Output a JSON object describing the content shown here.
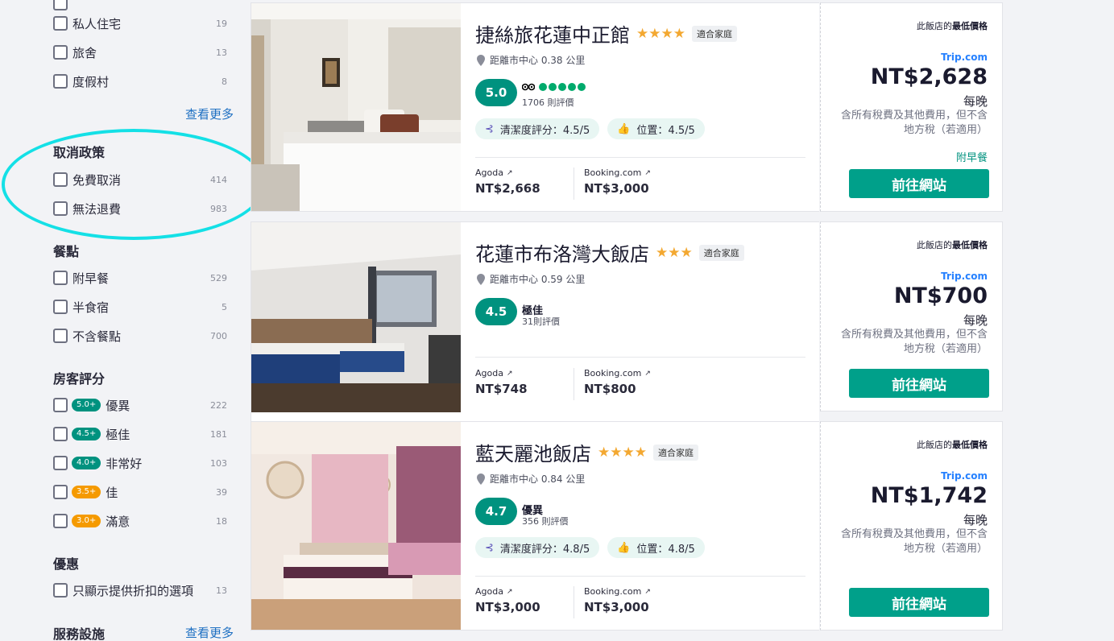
{
  "sidebar": {
    "property_types": [
      {
        "label": "私人住宅",
        "count": "19"
      },
      {
        "label": "旅舍",
        "count": "13"
      },
      {
        "label": "度假村",
        "count": "8"
      }
    ],
    "see_more": "查看更多",
    "cancellation": {
      "title": "取消政策",
      "items": [
        {
          "label": "免費取消",
          "count": "414"
        },
        {
          "label": "無法退費",
          "count": "983"
        }
      ]
    },
    "meals": {
      "title": "餐點",
      "items": [
        {
          "label": "附早餐",
          "count": "529"
        },
        {
          "label": "半食宿",
          "count": "5"
        },
        {
          "label": "不含餐點",
          "count": "700"
        }
      ]
    },
    "guest_rating": {
      "title": "房客評分",
      "items": [
        {
          "badge": "5.0+",
          "label": "優異",
          "count": "222",
          "color": "#00927f"
        },
        {
          "badge": "4.5+",
          "label": "極佳",
          "count": "181",
          "color": "#00927f"
        },
        {
          "badge": "4.0+",
          "label": "非常好",
          "count": "103",
          "color": "#00927f"
        },
        {
          "badge": "3.5+",
          "label": "佳",
          "count": "39",
          "color": "#f59a00"
        },
        {
          "badge": "3.0+",
          "label": "滿意",
          "count": "18",
          "color": "#f59a00"
        }
      ]
    },
    "deals": {
      "title": "優惠",
      "items": [
        {
          "label": "只顯示提供折扣的選項",
          "count": "13"
        }
      ]
    },
    "facilities": {
      "title": "服務設施",
      "see_more": "查看更多"
    }
  },
  "hotels": [
    {
      "name": "捷絲旅花蓮中正館",
      "stars": "★★★★",
      "tag": "適合家庭",
      "distance": "距離市中心 0.38 公里",
      "score": "5.0",
      "score_word": "",
      "reviews": "1706 則評價",
      "cleanliness": "清潔度評分：4.5/5",
      "location": "位置：4.5/5",
      "provider1": "Agoda",
      "provider1_price": "NT$2,668",
      "provider2": "Booking.com",
      "provider2_price": "NT$3,000",
      "best_label_prefix": "此飯店的",
      "best_label_bold": "最低價格",
      "source": "Trip.com",
      "price": "NT$2,628",
      "per_night": "每晚",
      "tax_note": "含所有稅費及其他費用，但不含地方稅（若適用）",
      "breakfast": "附早餐",
      "cta": "前往網站"
    },
    {
      "name": "花蓮市布洛灣大飯店",
      "stars": "★★★",
      "tag": "適合家庭",
      "distance": "距離市中心 0.59 公里",
      "score": "4.5",
      "score_word": "極佳",
      "reviews": "31則評價",
      "provider1": "Agoda",
      "provider1_price": "NT$748",
      "provider2": "Booking.com",
      "provider2_price": "NT$800",
      "best_label_prefix": "此飯店的",
      "best_label_bold": "最低價格",
      "source": "Trip.com",
      "price": "NT$700",
      "per_night": "每晚",
      "tax_note": "含所有稅費及其他費用，但不含地方稅（若適用）",
      "cta": "前往網站"
    },
    {
      "name": "藍天麗池飯店",
      "stars": "★★★★",
      "tag": "適合家庭",
      "distance": "距離市中心 0.84 公里",
      "score": "4.7",
      "score_word": "優異",
      "reviews": "356 則評價",
      "cleanliness": "清潔度評分：4.8/5",
      "location": "位置：4.8/5",
      "provider1": "Agoda",
      "provider1_price": "NT$3,000",
      "provider2": "Booking.com",
      "provider2_price": "NT$3,000",
      "best_label_prefix": "此飯店的",
      "best_label_bold": "最低價格",
      "source": "Trip.com",
      "price": "NT$1,742",
      "per_night": "每晚",
      "tax_note": "含所有稅費及其他費用，但不含地方稅（若適用）",
      "cta": "前往網站"
    }
  ]
}
